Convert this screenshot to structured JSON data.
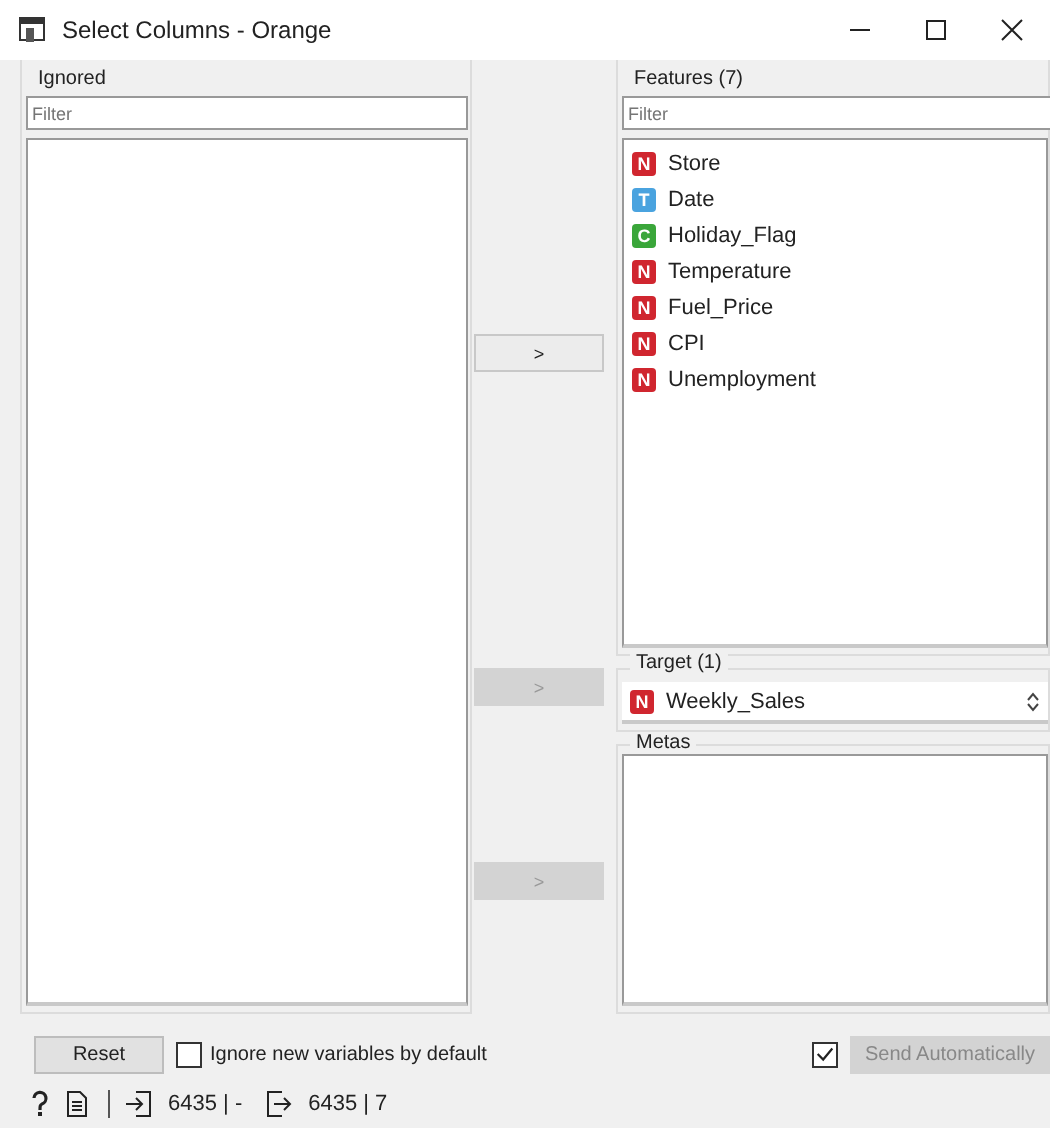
{
  "window": {
    "title": "Select Columns - Orange"
  },
  "ignored": {
    "title": "Ignored",
    "filter": {
      "placeholder": "Filter"
    }
  },
  "features": {
    "title": "Features (7)",
    "filter": {
      "placeholder": "Filter"
    },
    "items": [
      {
        "type": "N",
        "color": "#d0262f",
        "name": "Store"
      },
      {
        "type": "T",
        "color": "#4aa3df",
        "name": "Date"
      },
      {
        "type": "C",
        "color": "#3aa63a",
        "name": "Holiday_Flag"
      },
      {
        "type": "N",
        "color": "#d0262f",
        "name": "Temperature"
      },
      {
        "type": "N",
        "color": "#d0262f",
        "name": "Fuel_Price"
      },
      {
        "type": "N",
        "color": "#d0262f",
        "name": "CPI"
      },
      {
        "type": "N",
        "color": "#d0262f",
        "name": "Unemployment"
      }
    ]
  },
  "target": {
    "title": "Target (1)",
    "items": [
      {
        "type": "N",
        "color": "#d0262f",
        "name": "Weekly_Sales"
      }
    ]
  },
  "metas": {
    "title": "Metas"
  },
  "move_buttons": [
    {
      "label": ">",
      "disabled": false
    },
    {
      "label": ">",
      "disabled": true
    },
    {
      "label": ">",
      "disabled": true
    }
  ],
  "reset_button": {
    "label": "Reset"
  },
  "ignore_new": {
    "label": "Ignore new variables by default",
    "checked": false
  },
  "auto_send": {
    "checked": true,
    "label": "Send Automatically",
    "disabled": true
  },
  "status_bar": {
    "input": "6435 | -",
    "output": "6435 | 7"
  }
}
